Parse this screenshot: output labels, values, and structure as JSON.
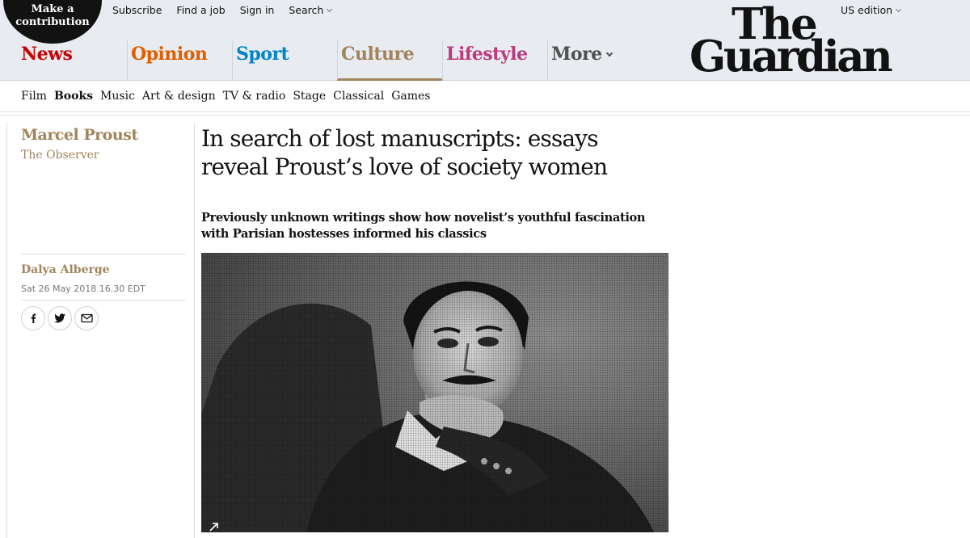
{
  "header": {
    "contribute": {
      "line1": "Make a",
      "line2": "contribution"
    },
    "top_links": [
      "Subscribe",
      "Find a job",
      "Sign in",
      "Search"
    ],
    "edition": "US edition",
    "logo": {
      "line1": "The",
      "line2": "Guardian"
    },
    "pillars": [
      {
        "label": "News",
        "color": "#c70000"
      },
      {
        "label": "Opinion",
        "color": "#e05e00"
      },
      {
        "label": "Sport",
        "color": "#0084c6"
      },
      {
        "label": "Culture",
        "color": "#a1845c"
      },
      {
        "label": "Lifestyle",
        "color": "#bb3b80"
      },
      {
        "label": "More",
        "color": "#505050"
      }
    ]
  },
  "subnav": [
    "Film",
    "Books",
    "Music",
    "Art & design",
    "TV & radio",
    "Stage",
    "Classical",
    "Games"
  ],
  "article": {
    "series": "Marcel Proust",
    "publication": "The Observer",
    "headline": "In search of lost manuscripts: essays reveal Proust’s love of society women",
    "standfirst": "Previously unknown writings show how novelist’s youthful fascination with Parisian hostesses informed his classics",
    "byline": "Dalya Alberge",
    "date": "Sat 26 May 2018 16.30 EDT",
    "share_icons": [
      "facebook-icon",
      "twitter-icon",
      "email-icon"
    ],
    "image_icon": "expand-icon"
  },
  "colors": {
    "culture_accent": "#a1845c",
    "header_bg": "#e8ecf0"
  }
}
